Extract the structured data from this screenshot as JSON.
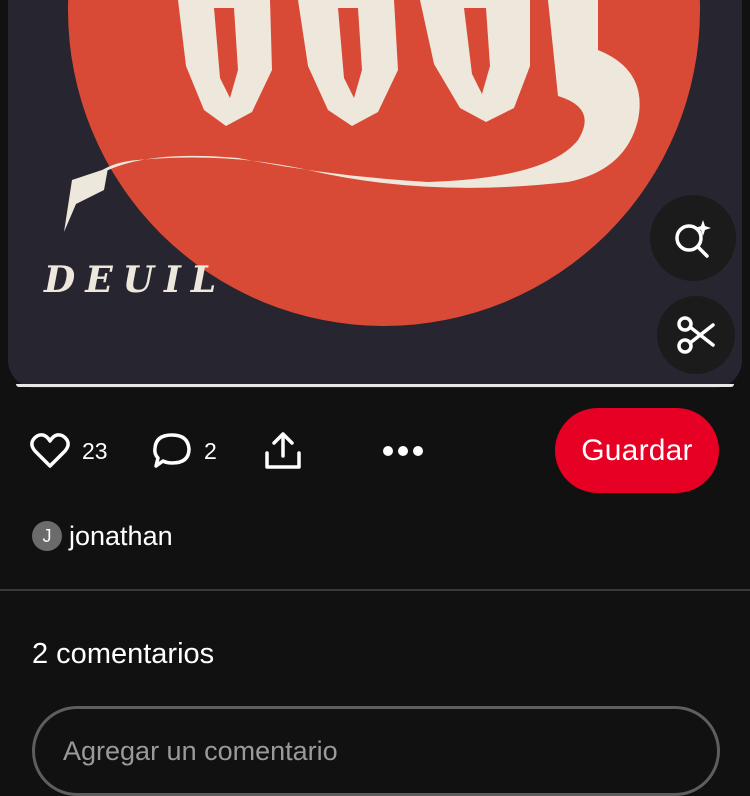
{
  "pin": {
    "image_caption": "DEUIL",
    "accent_red": "#d94a36",
    "background": "#272530"
  },
  "floating_buttons": {
    "visual_search_icon": "search-sparkle-icon",
    "cutout_icon": "scissors-icon"
  },
  "actions": {
    "like_icon": "heart-icon",
    "like_count": "23",
    "comment_icon": "comment-bubble-icon",
    "comment_count": "2",
    "share_icon": "share-upload-icon",
    "more_icon": "ellipsis-icon",
    "save_label": "Guardar",
    "save_color": "#e60023"
  },
  "author": {
    "avatar_initial": "J",
    "name": "jonathan"
  },
  "comments": {
    "title": "2 comentarios",
    "input_placeholder": "Agregar un comentario"
  }
}
